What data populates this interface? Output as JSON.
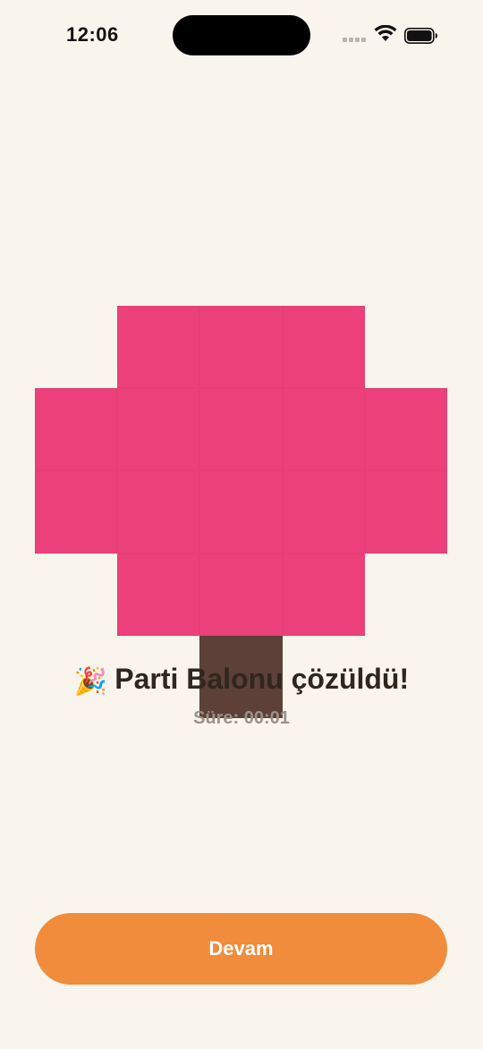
{
  "status_bar": {
    "time": "12:06"
  },
  "puzzle": {
    "grid": [
      [
        0,
        0,
        0,
        0,
        0
      ],
      [
        0,
        1,
        1,
        1,
        0
      ],
      [
        1,
        1,
        1,
        1,
        1
      ],
      [
        1,
        1,
        1,
        1,
        1
      ],
      [
        0,
        1,
        1,
        1,
        0
      ],
      [
        0,
        0,
        2,
        0,
        0
      ]
    ],
    "colors": {
      "0": "",
      "1": "#ec407a",
      "2": "#5d4037"
    }
  },
  "result": {
    "title": "Parti Balonu çözüldü!",
    "time_label": "Süre:",
    "time_value": "00:01"
  },
  "actions": {
    "continue_label": "Devam"
  },
  "colors": {
    "background": "#f9f4ec",
    "accent": "#f08c3c",
    "balloon": "#ec407a",
    "string": "#5d4037"
  }
}
